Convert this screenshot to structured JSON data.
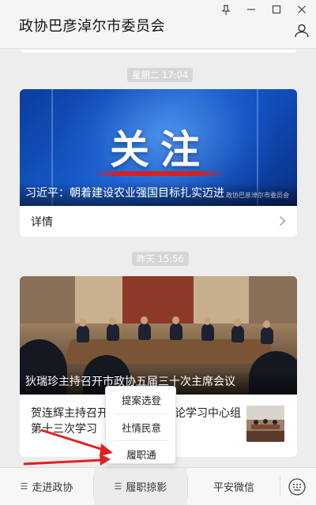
{
  "app": {
    "title": "政协巴彦淖尔市委员会"
  },
  "window": {
    "pin_icon": "pin-icon",
    "minimize_icon": "minimize-icon",
    "maximize_icon": "maximize-icon",
    "close_icon": "close-icon"
  },
  "feed": {
    "messages": [
      {
        "time": "星期二 17:04",
        "banner_text": "关注",
        "title": "习近平：朝着建设农业强国目标扎实迈进",
        "source": "政协巴彦淖尔市委员会",
        "detail_label": "详情"
      },
      {
        "time": "昨天 15:56",
        "title": "狄瑞珍主持召开市政协五届三十次主席会议",
        "sub_article": "贺连辉主持召开市政协党组理论学习中心组第十三次学习"
      }
    ]
  },
  "popup_menu": {
    "items": [
      "提案选登",
      "社情民意",
      "履职通"
    ]
  },
  "bottom_bar": {
    "tabs": [
      "走进政协",
      "履职掠影",
      "平安微信"
    ],
    "keyboard_icon": "keyboard-icon"
  },
  "colors": {
    "accent_red": "#e02020",
    "banner_blue": "#1a5fd0",
    "background": "#ededed"
  }
}
